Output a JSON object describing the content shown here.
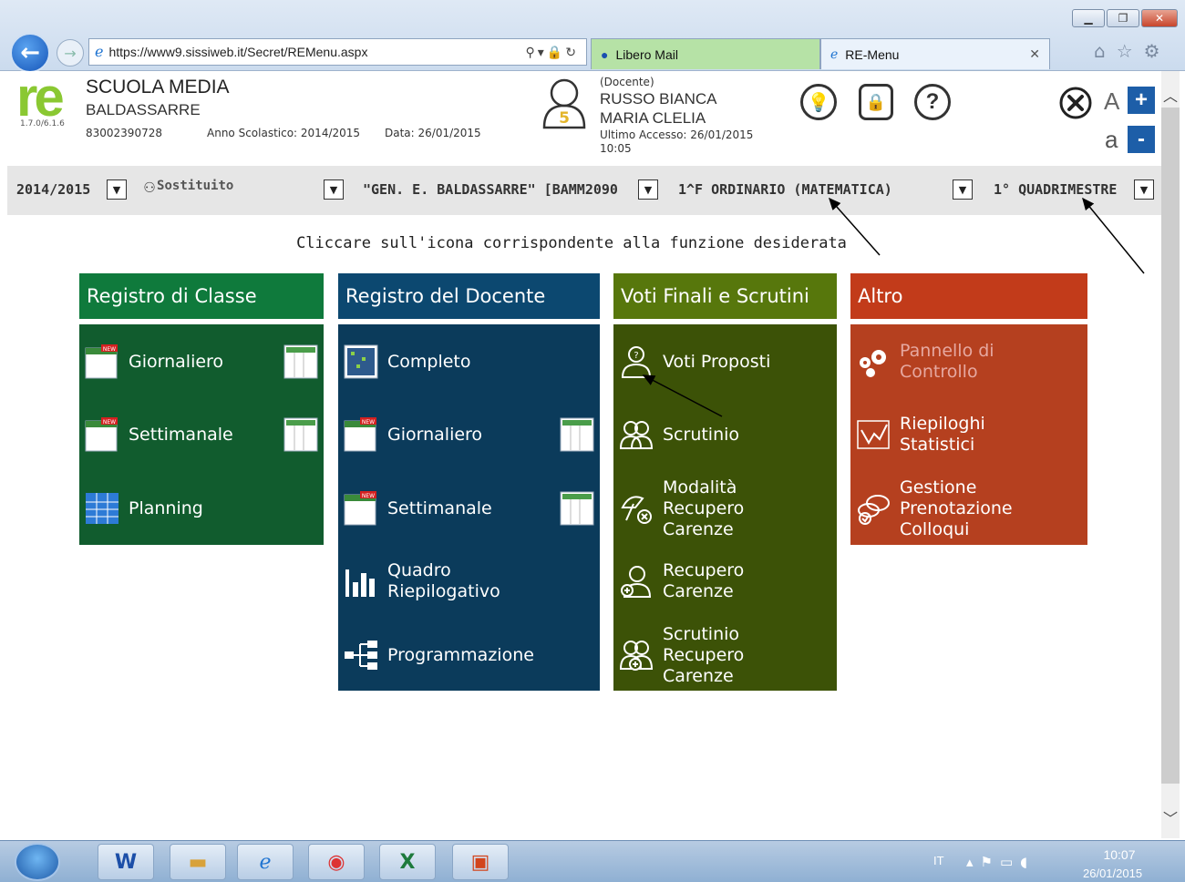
{
  "browser": {
    "url": "https://www9.sissiweb.it/Secret/REMenu.aspx",
    "tabs": [
      {
        "label": "Libero Mail"
      },
      {
        "label": "RE-Menu"
      }
    ]
  },
  "header": {
    "logo": "re",
    "version": "1.7.0/6.1.6",
    "school_line1": "SCUOLA MEDIA",
    "school_line2": "BALDASSARRE",
    "school_code": "83002390728",
    "anno": "Anno Scolastico: 2014/2015",
    "data": "Data: 26/01/2015",
    "user_badge": "5",
    "role": "(Docente)",
    "name_line1": "RUSSO BIANCA",
    "name_line2": "MARIA CLELIA",
    "last_access": "Ultimo Accesso: 26/01/2015 10:05",
    "font_big": "A",
    "font_small": "a",
    "plus": "+",
    "minus": "-"
  },
  "toolbar": {
    "year": "2014/2015",
    "substitute": "Sostituito",
    "school": "\"GEN. E. BALDASSARRE\" [BAMM2090",
    "class": "1^F ORDINARIO (MATEMATICA)",
    "period": "1° QUADRIMESTRE"
  },
  "instruction": "Cliccare sull'icona corrispondente alla funzione desiderata",
  "columns": [
    {
      "title": "Registro di Classe",
      "color": "#0f7a3c",
      "body_color": "#115c2e",
      "items": [
        {
          "label_lines": [
            "Giornaliero"
          ],
          "icon": "calendar-new-icon"
        },
        {
          "label_lines": [
            "Settimanale"
          ],
          "icon": "calendar-new-icon"
        },
        {
          "label_lines": [
            "Planning"
          ],
          "icon": "planning-grid-icon"
        }
      ]
    },
    {
      "title": "Registro del Docente",
      "color": "#0c4870",
      "body_color": "#0b3b5b",
      "items": [
        {
          "label_lines": [
            "Completo"
          ],
          "icon": "register-grid-icon"
        },
        {
          "label_lines": [
            "Giornaliero"
          ],
          "icon": "calendar-new-icon"
        },
        {
          "label_lines": [
            "Settimanale"
          ],
          "icon": "calendar-new-icon"
        },
        {
          "label_lines": [
            "Quadro",
            "Riepilogativo"
          ],
          "icon": "bar-chart-icon"
        },
        {
          "label_lines": [
            "Programmazione"
          ],
          "icon": "tree-icon"
        }
      ]
    },
    {
      "title": "Voti Finali e Scrutini",
      "color": "#57770c",
      "body_color": "#3c5207",
      "items": [
        {
          "label_lines": [
            "Voti Proposti"
          ],
          "icon": "user-question-icon"
        },
        {
          "label_lines": [
            "Scrutinio"
          ],
          "icon": "users-icon"
        },
        {
          "label_lines": [
            "Modalità",
            "Recupero",
            "Carenze"
          ],
          "icon": "umbrella-x-icon"
        },
        {
          "label_lines": [
            "Recupero",
            "Carenze"
          ],
          "icon": "user-plus-icon"
        },
        {
          "label_lines": [
            "Scrutinio",
            "Recupero",
            "Carenze"
          ],
          "icon": "users-plus-icon"
        }
      ]
    },
    {
      "title": "Altro",
      "color": "#c23b1a",
      "body_color": "#b5401f",
      "items": [
        {
          "label_lines": [
            "Pannello di",
            "Controllo"
          ],
          "icon": "gears-icon",
          "disabled": true
        },
        {
          "label_lines": [
            "Riepiloghi",
            "Statistici"
          ],
          "icon": "line-chart-icon"
        },
        {
          "label_lines": [
            "Gestione",
            "Prenotazione",
            "Colloqui"
          ],
          "icon": "speech-check-icon"
        }
      ]
    }
  ],
  "taskbar": {
    "lang": "IT",
    "time": "10:07",
    "date": "26/01/2015"
  }
}
